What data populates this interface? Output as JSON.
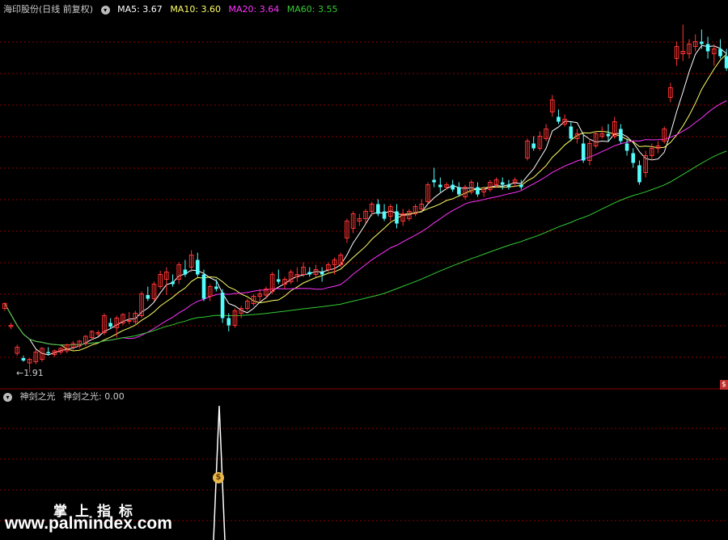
{
  "main": {
    "title": "海印股份(日线 前复权)",
    "ma": [
      {
        "label": "MA5: 3.67",
        "color": "#ffffff"
      },
      {
        "label": "MA10: 3.60",
        "color": "#ffff66"
      },
      {
        "label": "MA20: 3.64",
        "color": "#ff33ff"
      },
      {
        "label": "MA60: 3.55",
        "color": "#33cc33"
      }
    ],
    "low_marker": "←1.91",
    "colors": {
      "up": "#ff3333",
      "down": "#54fcfc",
      "grid": "#8b0000",
      "separator": "#8b0000"
    }
  },
  "indicator": {
    "name": "神剑之光",
    "value_label": "神剑之光: 0.00",
    "line_color": "#ffffff",
    "marker_icon": "$"
  },
  "watermark": {
    "cn": "掌上指标",
    "url": "www.palmindex.com"
  },
  "chart_data": {
    "type": "candlestick",
    "note_icons": [
      "dollar-coin-icon"
    ],
    "ohlc": [
      [
        2.44,
        2.49,
        2.42,
        2.48
      ],
      [
        2.29,
        2.32,
        2.27,
        2.3
      ],
      [
        2.07,
        2.14,
        2.05,
        2.12
      ],
      [
        2.03,
        2.05,
        2.0,
        2.01
      ],
      [
        1.99,
        2.03,
        1.91,
        2.02
      ],
      [
        2.0,
        2.1,
        1.98,
        2.08
      ],
      [
        2.02,
        2.12,
        2.0,
        2.11
      ],
      [
        2.08,
        2.12,
        2.05,
        2.07
      ],
      [
        2.06,
        2.1,
        2.04,
        2.09
      ],
      [
        2.08,
        2.12,
        2.06,
        2.11
      ],
      [
        2.09,
        2.15,
        2.07,
        2.14
      ],
      [
        2.12,
        2.17,
        2.1,
        2.15
      ],
      [
        2.13,
        2.18,
        2.11,
        2.17
      ],
      [
        2.15,
        2.22,
        2.13,
        2.21
      ],
      [
        2.2,
        2.26,
        2.18,
        2.25
      ],
      [
        2.23,
        2.26,
        2.21,
        2.24
      ],
      [
        2.24,
        2.4,
        2.22,
        2.38
      ],
      [
        2.32,
        2.36,
        2.27,
        2.29
      ],
      [
        2.28,
        2.38,
        2.2,
        2.36
      ],
      [
        2.32,
        2.4,
        2.3,
        2.39
      ],
      [
        2.34,
        2.41,
        2.31,
        2.34
      ],
      [
        2.33,
        2.42,
        2.3,
        2.4
      ],
      [
        2.38,
        2.58,
        2.36,
        2.56
      ],
      [
        2.55,
        2.62,
        2.5,
        2.52
      ],
      [
        2.52,
        2.66,
        2.5,
        2.64
      ],
      [
        2.62,
        2.75,
        2.6,
        2.72
      ],
      [
        2.68,
        2.78,
        2.55,
        2.74
      ],
      [
        2.66,
        2.72,
        2.62,
        2.64
      ],
      [
        2.68,
        2.82,
        2.64,
        2.8
      ],
      [
        2.76,
        2.84,
        2.7,
        2.72
      ],
      [
        2.78,
        2.92,
        2.74,
        2.88
      ],
      [
        2.84,
        2.9,
        2.7,
        2.72
      ],
      [
        2.72,
        2.76,
        2.5,
        2.52
      ],
      [
        2.54,
        2.64,
        2.5,
        2.62
      ],
      [
        2.62,
        2.68,
        2.58,
        2.6
      ],
      [
        2.57,
        2.6,
        2.32,
        2.36
      ],
      [
        2.36,
        2.4,
        2.25,
        2.3
      ],
      [
        2.3,
        2.44,
        2.28,
        2.42
      ],
      [
        2.4,
        2.46,
        2.36,
        2.44
      ],
      [
        2.44,
        2.52,
        2.42,
        2.5
      ],
      [
        2.48,
        2.56,
        2.46,
        2.54
      ],
      [
        2.54,
        2.6,
        2.5,
        2.56
      ],
      [
        2.55,
        2.62,
        2.52,
        2.6
      ],
      [
        2.58,
        2.74,
        2.56,
        2.72
      ],
      [
        2.68,
        2.76,
        2.64,
        2.66
      ],
      [
        2.64,
        2.7,
        2.6,
        2.68
      ],
      [
        2.66,
        2.76,
        2.64,
        2.74
      ],
      [
        2.7,
        2.78,
        2.66,
        2.72
      ],
      [
        2.72,
        2.82,
        2.7,
        2.78
      ],
      [
        2.74,
        2.78,
        2.7,
        2.72
      ],
      [
        2.72,
        2.8,
        2.7,
        2.76
      ],
      [
        2.74,
        2.78,
        2.66,
        2.72
      ],
      [
        2.76,
        2.82,
        2.74,
        2.8
      ],
      [
        2.8,
        2.86,
        2.72,
        2.84
      ],
      [
        2.8,
        2.9,
        2.78,
        2.88
      ],
      [
        3.02,
        3.18,
        2.98,
        3.16
      ],
      [
        3.1,
        3.24,
        3.06,
        3.22
      ],
      [
        3.16,
        3.22,
        3.12,
        3.18
      ],
      [
        3.18,
        3.26,
        3.14,
        3.24
      ],
      [
        3.24,
        3.32,
        3.2,
        3.3
      ],
      [
        3.3,
        3.34,
        3.2,
        3.22
      ],
      [
        3.24,
        3.3,
        3.16,
        3.18
      ],
      [
        3.2,
        3.3,
        3.16,
        3.28
      ],
      [
        3.24,
        3.3,
        3.1,
        3.14
      ],
      [
        3.16,
        3.26,
        3.12,
        3.22
      ],
      [
        3.18,
        3.26,
        3.16,
        3.24
      ],
      [
        3.22,
        3.3,
        3.2,
        3.28
      ],
      [
        3.26,
        3.34,
        3.24,
        3.3
      ],
      [
        3.32,
        3.48,
        3.3,
        3.46
      ],
      [
        3.5,
        3.6,
        3.44,
        3.48
      ],
      [
        3.46,
        3.52,
        3.4,
        3.44
      ],
      [
        3.44,
        3.48,
        3.42,
        3.46
      ],
      [
        3.46,
        3.5,
        3.4,
        3.42
      ],
      [
        3.44,
        3.48,
        3.36,
        3.38
      ],
      [
        3.36,
        3.46,
        3.34,
        3.44
      ],
      [
        3.4,
        3.5,
        3.38,
        3.48
      ],
      [
        3.44,
        3.48,
        3.36,
        3.38
      ],
      [
        3.4,
        3.44,
        3.36,
        3.42
      ],
      [
        3.42,
        3.5,
        3.4,
        3.48
      ],
      [
        3.46,
        3.52,
        3.44,
        3.5
      ],
      [
        3.48,
        3.52,
        3.42,
        3.46
      ],
      [
        3.46,
        3.5,
        3.42,
        3.44
      ],
      [
        3.48,
        3.52,
        3.44,
        3.5
      ],
      [
        3.46,
        3.5,
        3.42,
        3.44
      ],
      [
        3.68,
        3.84,
        3.66,
        3.82
      ],
      [
        3.8,
        3.86,
        3.74,
        3.76
      ],
      [
        3.76,
        3.9,
        3.74,
        3.86
      ],
      [
        3.84,
        3.96,
        3.82,
        3.92
      ],
      [
        4.06,
        4.2,
        4.02,
        4.16
      ],
      [
        4.02,
        4.08,
        3.96,
        3.98
      ],
      [
        3.96,
        4.04,
        3.94,
        4.0
      ],
      [
        3.94,
        3.98,
        3.82,
        3.84
      ],
      [
        3.84,
        3.92,
        3.8,
        3.88
      ],
      [
        3.8,
        3.88,
        3.64,
        3.66
      ],
      [
        3.66,
        3.84,
        3.62,
        3.8
      ],
      [
        3.78,
        3.9,
        3.76,
        3.88
      ],
      [
        3.86,
        3.94,
        3.84,
        3.88
      ],
      [
        3.88,
        3.96,
        3.82,
        3.86
      ],
      [
        3.86,
        4.02,
        3.84,
        3.98
      ],
      [
        3.92,
        3.96,
        3.8,
        3.82
      ],
      [
        3.8,
        3.84,
        3.7,
        3.74
      ],
      [
        3.72,
        3.76,
        3.6,
        3.64
      ],
      [
        3.62,
        3.66,
        3.46,
        3.48
      ],
      [
        3.56,
        3.74,
        3.52,
        3.7
      ],
      [
        3.7,
        3.8,
        3.66,
        3.76
      ],
      [
        3.76,
        3.82,
        3.72,
        3.78
      ],
      [
        3.82,
        3.94,
        3.8,
        3.92
      ],
      [
        4.18,
        4.3,
        4.14,
        4.26
      ],
      [
        4.5,
        4.64,
        4.44,
        4.6
      ],
      [
        4.54,
        4.78,
        4.48,
        4.56
      ],
      [
        4.54,
        4.66,
        4.5,
        4.62
      ],
      [
        4.6,
        4.7,
        4.56,
        4.64
      ],
      [
        4.64,
        4.74,
        4.58,
        4.62
      ],
      [
        4.62,
        4.68,
        4.5,
        4.56
      ],
      [
        4.54,
        4.62,
        4.44,
        4.58
      ],
      [
        4.58,
        4.66,
        4.5,
        4.52
      ],
      [
        4.52,
        4.58,
        4.4,
        4.42
      ]
    ],
    "indicator_values": "single spike near bar 64, otherwise 0"
  }
}
